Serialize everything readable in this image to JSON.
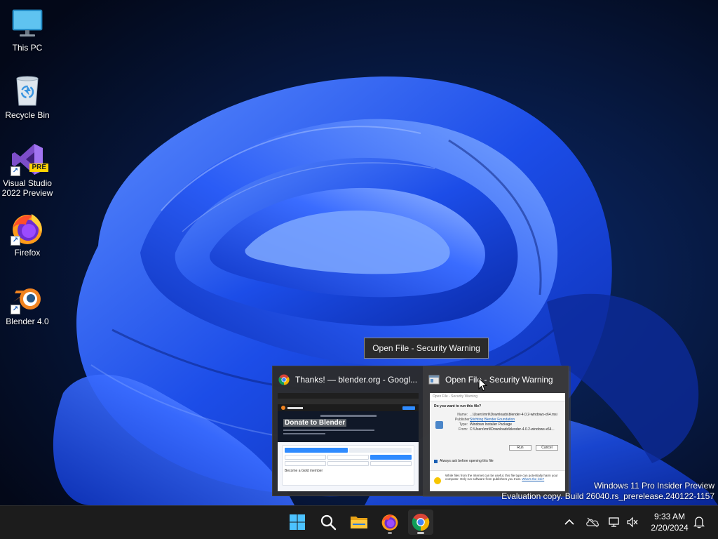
{
  "desktop": {
    "icons": [
      {
        "label": "This PC",
        "icon": "monitor-icon"
      },
      {
        "label": "Recycle Bin",
        "icon": "recycle-bin-icon"
      },
      {
        "label": "Visual Studio 2022 Preview",
        "icon": "visual-studio-icon",
        "badge": "PRE"
      },
      {
        "label": "Firefox",
        "icon": "firefox-icon"
      },
      {
        "label": "Blender 4.0",
        "icon": "blender-icon"
      }
    ]
  },
  "tooltip": {
    "text": "Open File - Security Warning"
  },
  "flyout": {
    "thumbnails": [
      {
        "title": "Thanks! — blender.org - Googl...",
        "icon": "chrome-icon",
        "preview": {
          "heading": "Donate to Blender",
          "footer_text": "Become a Gold member"
        }
      },
      {
        "title": "Open File - Security Warning",
        "icon": "dialog-icon",
        "preview": {
          "dialog_title": "Open File - Security Warning",
          "question": "Do you want to run this file?",
          "fields": [
            {
              "label": "Name:",
              "value": "...\\Users\\mrli\\Downloads\\blender-4.0.2-windows-x64.msi"
            },
            {
              "label": "Publisher:",
              "value": "Stichting Blender Foundation"
            },
            {
              "label": "Type:",
              "value": "Windows Installer Package"
            },
            {
              "label": "From:",
              "value": "C:\\Users\\mrli\\Downloads\\blender-4.0.2-windows-x64..."
            }
          ],
          "run_label": "Run",
          "cancel_label": "Cancel",
          "checkbox_label": "Always ask before opening this file",
          "warning_text": "While files from the Internet can be useful, this file type can potentially harm your computer. Only run software from publishers you trust.",
          "warning_link": "What's the risk?"
        }
      }
    ]
  },
  "watermark": {
    "line1": "Windows 11 Pro Insider Preview",
    "line2": "Evaluation copy. Build 26040.rs_prerelease.240122-1157"
  },
  "taskbar": {
    "apps": [
      {
        "name": "start-button",
        "icon": "windows-logo-icon"
      },
      {
        "name": "search-button",
        "icon": "search-icon"
      },
      {
        "name": "file-explorer-button",
        "icon": "folder-icon"
      },
      {
        "name": "firefox-taskbar-button",
        "icon": "firefox-icon"
      },
      {
        "name": "chrome-taskbar-button",
        "icon": "chrome-icon"
      }
    ],
    "tray": {
      "time": "9:33 AM",
      "date": "2/20/2024"
    }
  },
  "colors": {
    "taskbar": "#1c1c1c",
    "wallpaper_dark": "#050c22",
    "bloom_blue": "#1f55f0",
    "accent": "#1a73e8"
  }
}
